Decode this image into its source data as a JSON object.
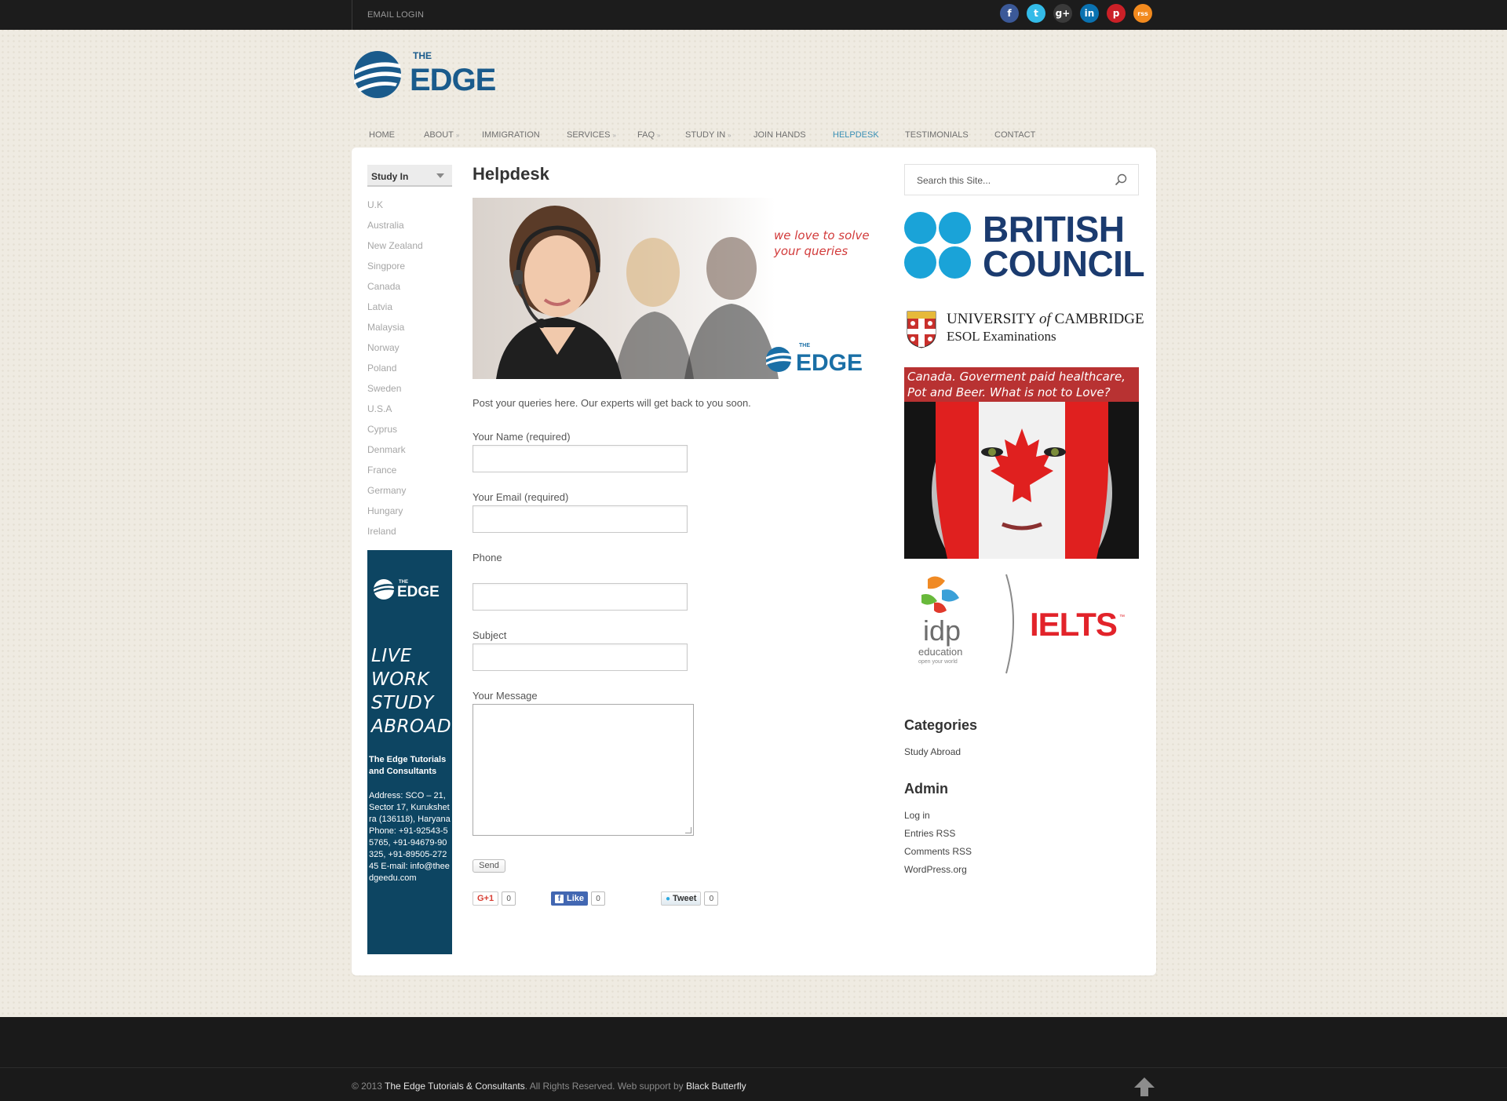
{
  "topbar": {
    "email_login": "EMAIL LOGIN",
    "social_icons": [
      {
        "name": "facebook-icon",
        "glyph": "f",
        "color": "#3b5998"
      },
      {
        "name": "twitter-icon",
        "glyph": "t",
        "color": "#33bbe8"
      },
      {
        "name": "google-plus-icon",
        "glyph": "g+",
        "color": "#3a3a3a"
      },
      {
        "name": "linkedin-icon",
        "glyph": "in",
        "color": "#0a72b1"
      },
      {
        "name": "pinterest-icon",
        "glyph": "p",
        "color": "#cb2027"
      },
      {
        "name": "rss-icon",
        "glyph": "rss",
        "color": "#f28a1e"
      }
    ]
  },
  "logo": {
    "small": "THE",
    "big": "EDGE"
  },
  "nav": {
    "items": [
      {
        "label": "HOME",
        "has_arrow": false
      },
      {
        "label": "ABOUT",
        "has_arrow": true
      },
      {
        "label": "IMMIGRATION",
        "has_arrow": false
      },
      {
        "label": "SERVICES",
        "has_arrow": true
      },
      {
        "label": "FAQ",
        "has_arrow": true
      },
      {
        "label": "STUDY IN",
        "has_arrow": true
      },
      {
        "label": "JOIN HANDS",
        "has_arrow": false
      },
      {
        "label": "HELPDESK",
        "has_arrow": false,
        "active": true
      },
      {
        "label": "TESTIMONIALS",
        "has_arrow": false
      },
      {
        "label": "CONTACT",
        "has_arrow": false
      }
    ],
    "active_color": "#3a8fb5"
  },
  "left_sidebar": {
    "select_label": "Study In",
    "countries": [
      "U.K",
      "Australia",
      "New Zealand",
      "Singpore",
      "Canada",
      "Latvia",
      "Malaysia",
      "Norway",
      "Poland",
      "Sweden",
      "U.S.A",
      "Cyprus",
      "Denmark",
      "France",
      "Germany",
      "Hungary",
      "Ireland"
    ],
    "promo": {
      "tagline": [
        "LIVE",
        "WORK",
        "STUDY",
        "ABROAD"
      ],
      "company": "The Edge Tutorials and Consultants",
      "address": "Address: SCO – 21, Sector 17, Kurukshetra (136118), Haryana Phone: +91-92543-55765, +91-94679-90325, +91-89505-27245 E-mail: info@theedgeedu.com"
    }
  },
  "main": {
    "title": "Helpdesk",
    "hero_tagline": [
      "we love to solve",
      "your queries"
    ],
    "intro": "Post your queries here. Our experts will get back to you soon.",
    "form": {
      "name_label": "Your Name (required)",
      "email_label": "Your Email (required)",
      "phone_label": "Phone",
      "subject_label": "Subject",
      "message_label": "Your Message",
      "send_label": "Send"
    },
    "share": {
      "gplus_label": "G+1",
      "gplus_count": "0",
      "like_label": "Like",
      "like_count": "0",
      "tweet_label": "Tweet",
      "tweet_count": "0"
    }
  },
  "right_sidebar": {
    "search_placeholder": "Search this Site...",
    "british_council": [
      "BRITISH",
      "COUNCIL"
    ],
    "cambridge": {
      "line1_a": "UNIVERSITY ",
      "line1_of": "of",
      "line1_b": " CAMBRIDGE",
      "line2": "ESOL Examinations"
    },
    "canada_banner": [
      "Canada. Goverment paid healthcare,",
      "Pot and Beer. What is not to Love?"
    ],
    "idp": {
      "idp": "idp",
      "education": "education",
      "tagline": "open your world",
      "ielts": "IELTS"
    },
    "categories_title": "Categories",
    "categories": [
      "Study Abroad"
    ],
    "admin_title": "Admin",
    "admin_links": [
      "Log in",
      "Entries RSS",
      "Comments RSS",
      "WordPress.org"
    ]
  },
  "footer": {
    "copyright_prefix": "© 2013",
    "company": "The Edge Tutorials & Consultants",
    "rights": ". All Rights Reserved. Web support by",
    "support": "Black Butterfly"
  }
}
